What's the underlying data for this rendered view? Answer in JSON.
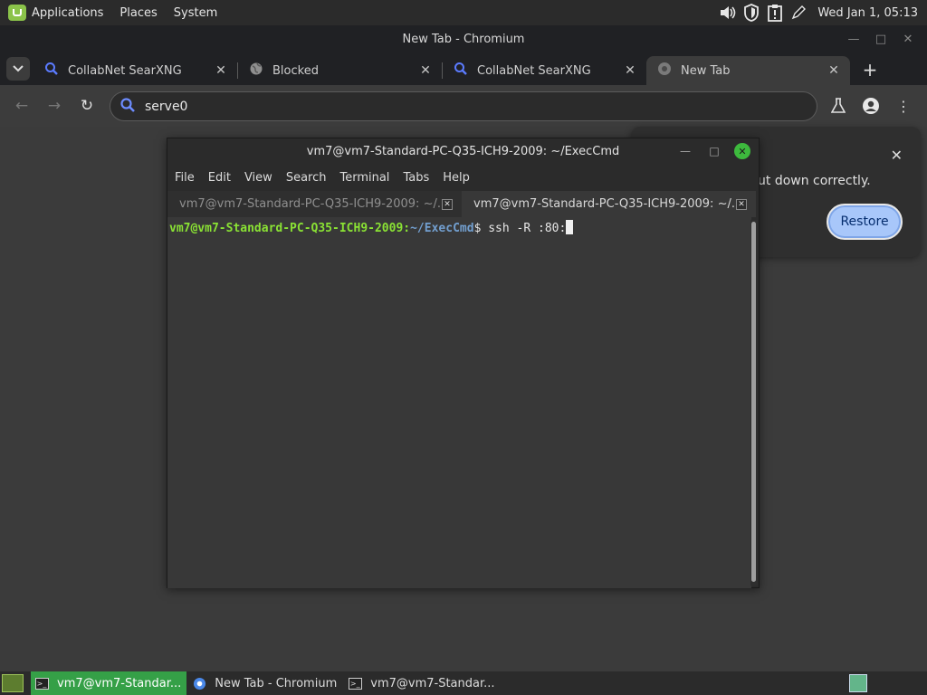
{
  "top_panel": {
    "menus": [
      "Applications",
      "Places",
      "System"
    ],
    "clock": "Wed Jan  1, 05:13",
    "tray_icons": [
      "volume-icon",
      "shield-icon",
      "clipboard-alert-icon",
      "pen-icon"
    ]
  },
  "browser": {
    "window_title": "New Tab - Chromium",
    "tabs": [
      {
        "title": "CollabNet SearXNG",
        "icon": "search-icon"
      },
      {
        "title": "Blocked",
        "icon": "globe-icon"
      },
      {
        "title": "CollabNet SearXNG",
        "icon": "search-icon"
      },
      {
        "title": "New Tab",
        "icon": "chromium-icon",
        "active": true
      }
    ],
    "omnibox_text": "serve0",
    "restore_bubble": {
      "text": "ut down correctly.",
      "button": "Restore"
    }
  },
  "terminal": {
    "title": "vm7@vm7-Standard-PC-Q35-ICH9-2009: ~/ExecCmd",
    "menu": [
      "File",
      "Edit",
      "View",
      "Search",
      "Terminal",
      "Tabs",
      "Help"
    ],
    "tabs": [
      {
        "label": "vm7@vm7-Standard-PC-Q35-ICH9-2009: ~/..."
      },
      {
        "label": "vm7@vm7-Standard-PC-Q35-ICH9-2009: ~/...",
        "active": true
      }
    ],
    "prompt_user": "vm7@vm7-Standard-PC-Q35-ICH9-2009",
    "prompt_sep": ":",
    "prompt_path": "~/ExecCmd",
    "prompt_symbol": "$ ",
    "command": "ssh -R :80:"
  },
  "taskbar": {
    "items": [
      {
        "label": "vm7@vm7-Standar...",
        "icon": "terminal-icon",
        "active": true
      },
      {
        "label": "New Tab - Chromium",
        "icon": "chromium-icon"
      },
      {
        "label": "vm7@vm7-Standar...",
        "icon": "terminal-icon"
      }
    ]
  },
  "colors": {
    "prompt_user": "#8ae234",
    "prompt_path": "#729fcf",
    "active_task": "#35a047",
    "restore_button": "#a8c7fa"
  }
}
